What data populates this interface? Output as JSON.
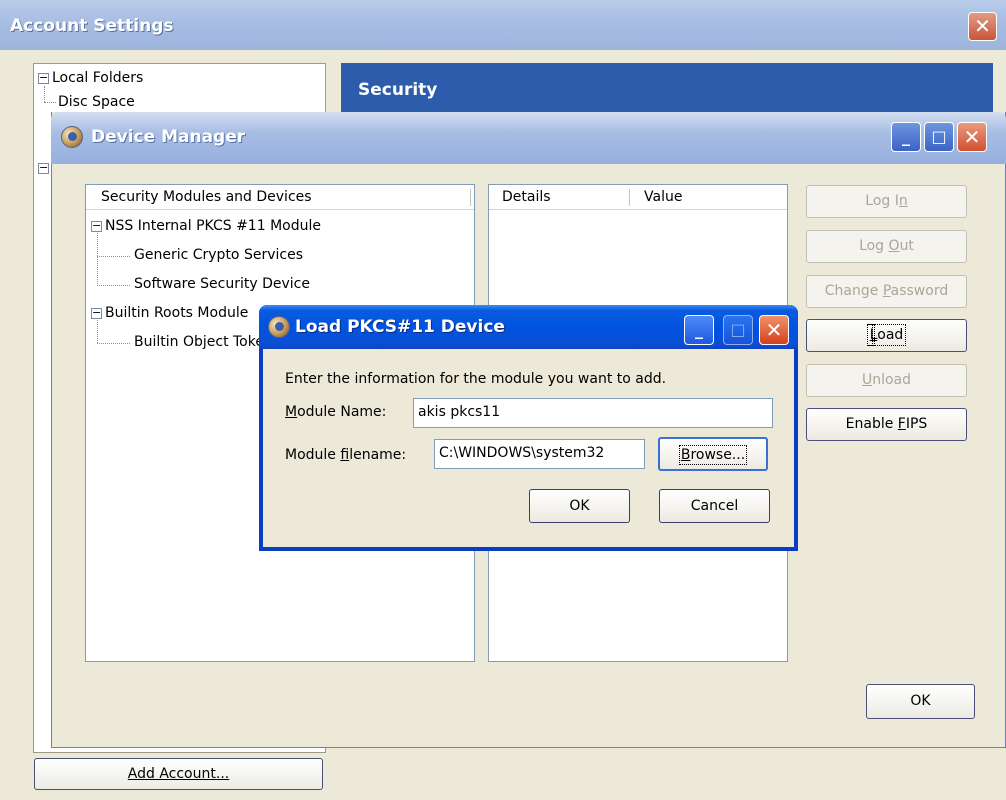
{
  "account_settings": {
    "title": "Account Settings",
    "close_label": "✕",
    "tree": {
      "items": [
        {
          "label": "Local Folders",
          "expander": "−"
        },
        {
          "label": "Disc Space"
        }
      ],
      "second_expander": "−"
    },
    "header_title": "Security",
    "add_account_label": "Add Account..."
  },
  "device_manager": {
    "title": "Device Manager",
    "controls": {
      "minimize": "_",
      "maximize": "□",
      "close": "✕"
    },
    "modules_panel": {
      "header": "Security Modules and Devices",
      "nodes": [
        {
          "label": "NSS Internal PKCS #11 Module",
          "expander": "−"
        },
        {
          "label": "Generic Crypto Services"
        },
        {
          "label": "Software Security Device"
        },
        {
          "label": "Builtin Roots Module",
          "expander": "−"
        },
        {
          "label": "Builtin Object Token"
        }
      ]
    },
    "details_panel": {
      "col_details": "Details",
      "col_value": "Value"
    },
    "buttons": {
      "log_in": {
        "pre": "Log I",
        "key": "n",
        "post": ""
      },
      "log_out": {
        "pre": "Log ",
        "key": "O",
        "post": "ut"
      },
      "change_password": {
        "pre": "Change ",
        "key": "P",
        "post": "assword"
      },
      "load": {
        "pre": "",
        "key": "L",
        "post": "oad"
      },
      "unload": {
        "pre": "",
        "key": "U",
        "post": "nload"
      },
      "enable_fips": {
        "pre": "Enable ",
        "key": "F",
        "post": "IPS"
      },
      "ok": "OK"
    }
  },
  "load_dialog": {
    "title": "Load PKCS#11 Device",
    "controls": {
      "minimize": "_",
      "maximize": "□",
      "close": "✕"
    },
    "instruction": "Enter the information for the module you want to add.",
    "module_name_label": {
      "pre": "",
      "key": "M",
      "post": "odule Name:"
    },
    "module_name_value": "akis pkcs11",
    "module_filename_label": {
      "pre": "Module ",
      "key": "f",
      "post": "ilename:"
    },
    "module_filename_value": "C:\\WINDOWS\\system32",
    "browse": {
      "pre": "",
      "key": "B",
      "post": "rowse..."
    },
    "ok": "OK",
    "cancel": "Cancel"
  }
}
